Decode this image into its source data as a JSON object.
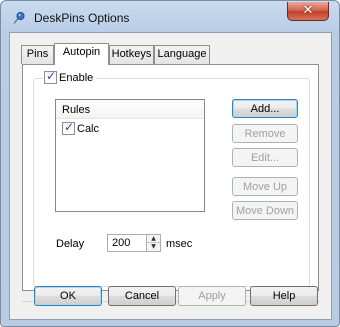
{
  "window": {
    "title": "DeskPins Options",
    "close_glyph": "✕",
    "icon": "deskpins-pin-icon"
  },
  "tabs": [
    {
      "label": "Pins",
      "active": false
    },
    {
      "label": "Autopin",
      "active": true
    },
    {
      "label": "Hotkeys",
      "active": false
    },
    {
      "label": "Language",
      "active": false
    }
  ],
  "autopin": {
    "enable_label": "Enable",
    "enable_checked": true,
    "rules": {
      "header": "Rules",
      "items": [
        {
          "label": "Calc",
          "checked": true
        }
      ]
    },
    "buttons": {
      "add": "Add...",
      "remove": "Remove",
      "edit": "Edit...",
      "move_up": "Move Up",
      "move_down": "Move Down"
    },
    "delay": {
      "label": "Delay",
      "value": "200",
      "unit": "msec"
    }
  },
  "footer": {
    "ok": "OK",
    "cancel": "Cancel",
    "apply": "Apply",
    "help": "Help"
  },
  "colors": {
    "frame": "#b9cde6",
    "close_button": "#c7432c",
    "checkmark": "#2f4b8a",
    "default_button_border": "#3c7fb1"
  }
}
